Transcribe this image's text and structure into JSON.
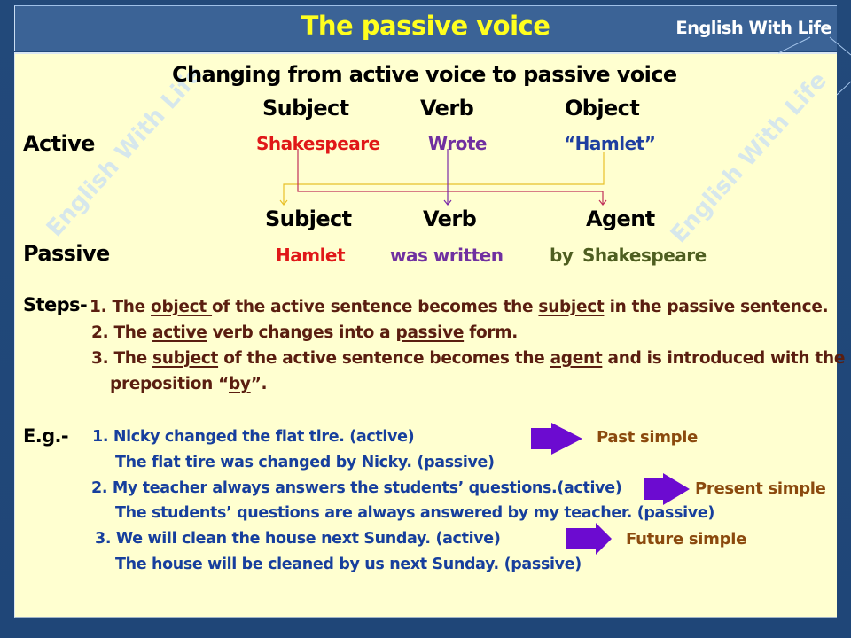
{
  "header": {
    "title": "The passive voice",
    "brand": "English With Life"
  },
  "watermark": "English With Life",
  "heading": "Changing from active voice to passive voice",
  "active": {
    "row_label": "Active",
    "columns": [
      "Subject",
      "Verb",
      "Object"
    ],
    "values": [
      "Shakespeare",
      "Wrote",
      "“Hamlet”"
    ]
  },
  "passive": {
    "row_label": "Passive",
    "columns": [
      "Subject",
      "Verb",
      "Agent"
    ],
    "values": [
      "Hamlet",
      "was written",
      "by",
      "Shakespeare"
    ]
  },
  "colors": {
    "subject_red": "#e01818",
    "verb_purple": "#7030a0",
    "object_blue": "#1f3fa0",
    "agent_green": "#4e5e20",
    "arrow_yellow": "#e8c02a",
    "arrow_magenta": "#c0305a",
    "arrow_purple": "#7a2aa8",
    "block_arrow": "#6c0bd0"
  },
  "steps": {
    "label": "Steps-",
    "items": [
      {
        "parts": [
          "1. The ",
          "object ",
          "of the active sentence becomes the ",
          "subject",
          " in the passive sentence."
        ]
      },
      {
        "parts": [
          "2. The ",
          "active",
          " verb changes into a ",
          "passive",
          " form."
        ]
      },
      {
        "parts": [
          "3. The ",
          "subject",
          " of the active sentence becomes the ",
          "agent",
          " and is introduced with the"
        ]
      },
      {
        "parts": [
          "preposition “",
          "by",
          "”."
        ]
      }
    ]
  },
  "examples": {
    "label": "E.g.-",
    "items": [
      {
        "active": "1. Nicky changed the flat tire. (active)",
        "passive": "The flat tire was changed by Nicky. (passive)",
        "tense": "Past simple"
      },
      {
        "active": "2.  My teacher always answers the students’ questions.(active)",
        "passive": "The students’ questions are always answered by my teacher. (passive)",
        "tense": "Present simple"
      },
      {
        "active": "3. We will clean the house next Sunday. (active)",
        "passive": "The house will be cleaned by us next Sunday. (passive)",
        "tense": "Future simple"
      }
    ]
  }
}
